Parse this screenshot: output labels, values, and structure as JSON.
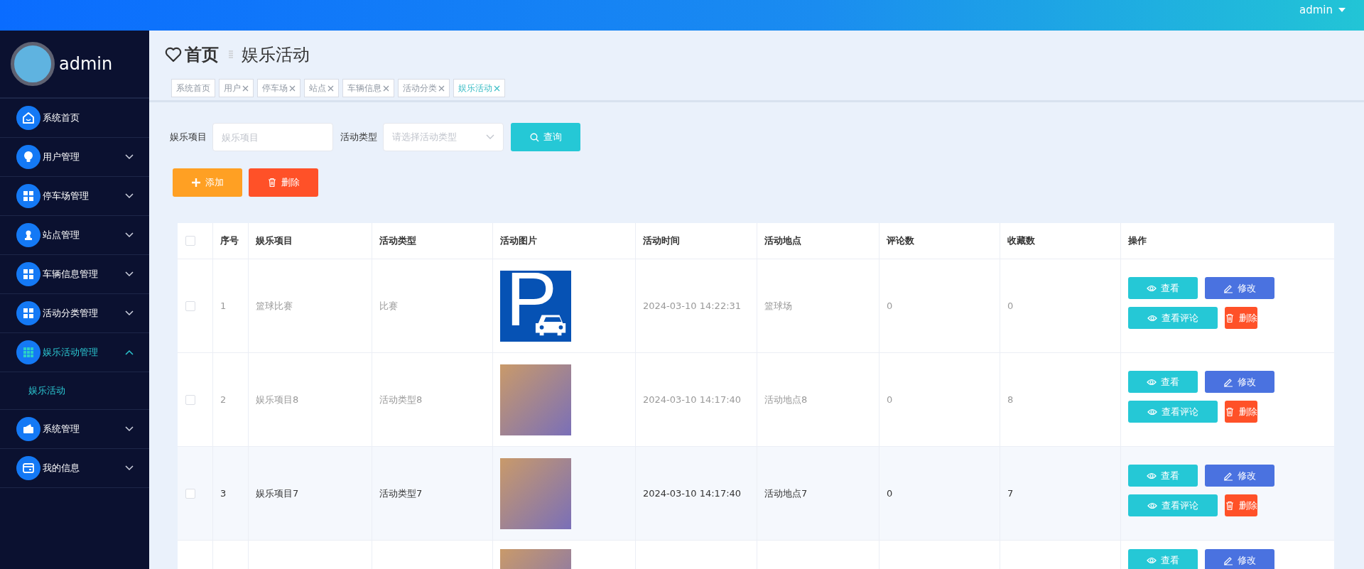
{
  "top_bar": {
    "user": "admin"
  },
  "sidebar": {
    "user_name": "admin",
    "items": [
      {
        "label": "系统首页",
        "kind": "link",
        "selected": false
      },
      {
        "label": "用户管理",
        "kind": "submenu",
        "expanded": false,
        "selected": false
      },
      {
        "label": "停车场管理",
        "kind": "submenu",
        "expanded": false,
        "selected": false
      },
      {
        "label": "站点管理",
        "kind": "submenu",
        "expanded": false,
        "selected": false
      },
      {
        "label": "车辆信息管理",
        "kind": "submenu",
        "expanded": false,
        "selected": false
      },
      {
        "label": "活动分类管理",
        "kind": "submenu",
        "expanded": false,
        "selected": false
      },
      {
        "label": "娱乐活动管理",
        "kind": "submenu",
        "expanded": true,
        "selected": true,
        "children": [
          {
            "label": "娱乐活动",
            "selected": true
          }
        ]
      },
      {
        "label": "系统管理",
        "kind": "submenu",
        "expanded": false,
        "selected": false
      },
      {
        "label": "我的信息",
        "kind": "submenu",
        "expanded": false,
        "selected": false
      }
    ]
  },
  "breadcrumb": {
    "home": "首页",
    "current": "娱乐活动"
  },
  "tabs": [
    {
      "label": "系统首页",
      "closable": false,
      "selected": false
    },
    {
      "label": "用户",
      "closable": true,
      "selected": false
    },
    {
      "label": "停车场",
      "closable": true,
      "selected": false
    },
    {
      "label": "站点",
      "closable": true,
      "selected": false
    },
    {
      "label": "车辆信息",
      "closable": true,
      "selected": false
    },
    {
      "label": "活动分类",
      "closable": true,
      "selected": false
    },
    {
      "label": "娱乐活动",
      "closable": true,
      "selected": true
    }
  ],
  "search": {
    "fields": [
      {
        "label": "娱乐项目",
        "kind": "input",
        "placeholder": "娱乐项目"
      },
      {
        "label": "活动类型",
        "kind": "select",
        "placeholder": "请选择活动类型"
      }
    ],
    "button": "查询"
  },
  "toolbar": [
    {
      "label": "添加",
      "kind": "add"
    },
    {
      "label": "删除",
      "kind": "delete"
    }
  ],
  "table": {
    "header_checked": false,
    "columns": [
      "序号",
      "娱乐项目",
      "活动类型",
      "活动图片",
      "活动时间",
      "活动地点",
      "评论数",
      "收藏数",
      "操作"
    ],
    "rows": [
      {
        "checked": false,
        "highlighted": false,
        "index": "1",
        "name": "篮球比赛",
        "type": "比赛",
        "image": "P",
        "time": "2024-03-10 14:22:31",
        "place": "篮球场",
        "comments": "0",
        "favorites": "0",
        "actions": [
          {
            "label": "查看",
            "kind": "view"
          },
          {
            "label": "修改",
            "kind": "edit"
          },
          {
            "label": "查看评论",
            "kind": "comments"
          },
          {
            "label": "删除",
            "kind": "delete"
          }
        ]
      },
      {
        "checked": false,
        "highlighted": false,
        "index": "2",
        "name": "娱乐项目8",
        "type": "活动类型8",
        "time": "2024-03-10 14:17:40",
        "place": "活动地点8",
        "comments": "0",
        "favorites": "8",
        "actions": [
          {
            "label": "查看",
            "kind": "view"
          },
          {
            "label": "修改",
            "kind": "edit"
          },
          {
            "label": "查看评论",
            "kind": "comments"
          },
          {
            "label": "删除",
            "kind": "delete"
          }
        ]
      },
      {
        "checked": false,
        "highlighted": true,
        "index": "3",
        "name": "娱乐项目7",
        "type": "活动类型7",
        "time": "2024-03-10 14:17:40",
        "place": "活动地点7",
        "comments": "0",
        "favorites": "7",
        "actions": [
          {
            "label": "查看",
            "kind": "view"
          },
          {
            "label": "修改",
            "kind": "edit"
          },
          {
            "label": "查看评论",
            "kind": "comments"
          },
          {
            "label": "删除",
            "kind": "delete"
          }
        ]
      },
      {
        "actions": [
          {
            "label": "查看",
            "kind": "view"
          },
          {
            "label": "修改",
            "kind": "edit"
          }
        ]
      }
    ]
  }
}
